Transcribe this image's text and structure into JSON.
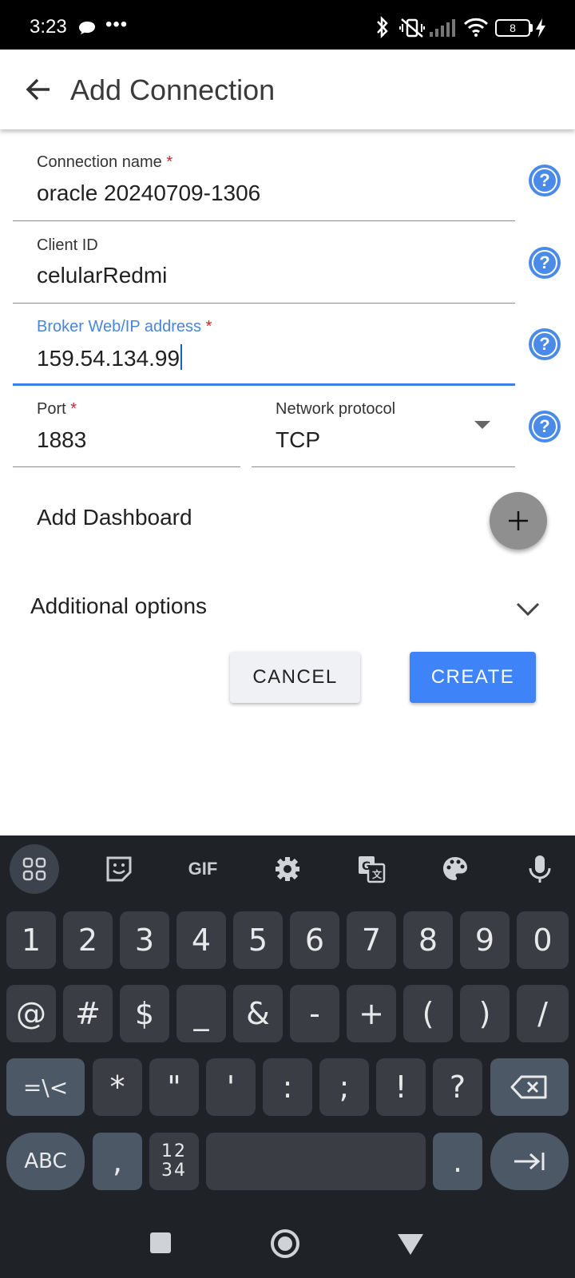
{
  "status_bar": {
    "time": "3:23",
    "more": "•••",
    "battery_level": "8"
  },
  "app_bar": {
    "title": "Add Connection"
  },
  "form": {
    "connection_name": {
      "label": "Connection name",
      "required_mark": "*",
      "value": "oracle 20240709-1306"
    },
    "client_id": {
      "label": "Client ID",
      "value": "celularRedmi"
    },
    "broker_address": {
      "label": "Broker Web/IP address",
      "required_mark": "*",
      "value": "159.54.134.99"
    },
    "port": {
      "label": "Port",
      "required_mark": "*",
      "value": "1883"
    },
    "network_protocol": {
      "label": "Network protocol",
      "value": "TCP"
    },
    "help_glyph": "?",
    "add_dashboard": "Add Dashboard",
    "additional_options": "Additional options",
    "cancel_label": "CANCEL",
    "create_label": "CREATE"
  },
  "colors": {
    "accent": "#3f83f8",
    "help": "#4a8ae8",
    "required": "#c62828",
    "keyboard_bg": "#1f2227"
  },
  "keyboard": {
    "toolbar": {
      "gif": "GIF"
    },
    "row1": [
      "1",
      "2",
      "3",
      "4",
      "5",
      "6",
      "7",
      "8",
      "9",
      "0"
    ],
    "row2": [
      "@",
      "#",
      "$",
      "_",
      "&",
      "-",
      "+",
      "(",
      ")",
      "/"
    ],
    "row3": [
      "=\\<",
      "*",
      "\"",
      "'",
      ":",
      ";",
      "!",
      "?"
    ],
    "row4": {
      "abc": "ABC",
      "comma": ",",
      "numpad_top": "12",
      "numpad_bottom": "34",
      "period": "."
    }
  }
}
